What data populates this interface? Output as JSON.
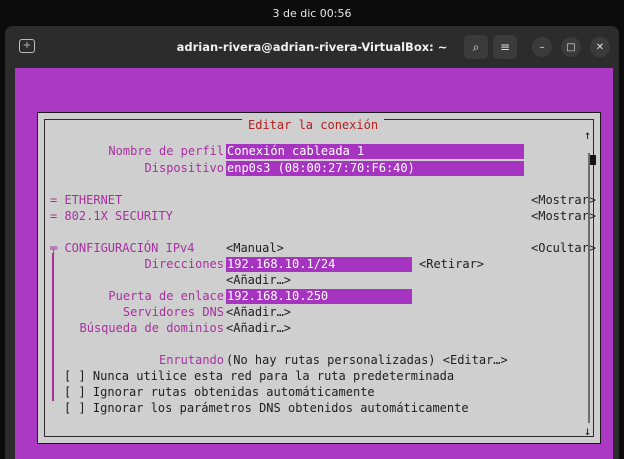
{
  "topbar": {
    "clock": "3 de dic  00:56"
  },
  "window": {
    "title": "adrian-rivera@adrian-rivera-VirtualBox: ~"
  },
  "dialog": {
    "title": "Editar la conexión",
    "profile_label": "Nombre de perfil",
    "profile_value": "Conexión cableada 1",
    "device_label": "Dispositivo",
    "device_value": "enp0s3 (08:00:27:70:F6:40)",
    "ethernet_label": "= ETHERNET",
    "ethernet_action": "<Mostrar>",
    "security_label": "= 802.1X SECURITY",
    "security_action": "<Mostrar>",
    "ipv4_label": "╤ CONFIGURACIÓN IPv4",
    "ipv4_method": "<Manual>",
    "ipv4_action": "<Ocultar>",
    "addresses_label": "Direcciones",
    "address_value": "192.168.10.1/24",
    "remove_button": "<Retirar>",
    "add_address": "<Añadir…>",
    "gateway_label": "Puerta de enlace",
    "gateway_value": "192.168.10.250",
    "dns_label": "Servidores DNS",
    "dns_add": "<Añadir…>",
    "search_label": "Búsqueda de dominios",
    "search_add": "<Añadir…>",
    "routing_label": "Enrutando",
    "routing_value": "(No hay rutas personalizadas) <Editar…>",
    "check1": "[ ] Nunca utilice esta red para la ruta predeterminada",
    "check2": "[ ] Ignorar rutas obtenidas automáticamente",
    "check3": "[ ] Ignorar los parámetros DNS obtenidos automáticamente"
  },
  "scrollbar": {
    "up": "↑",
    "down": "↓"
  }
}
